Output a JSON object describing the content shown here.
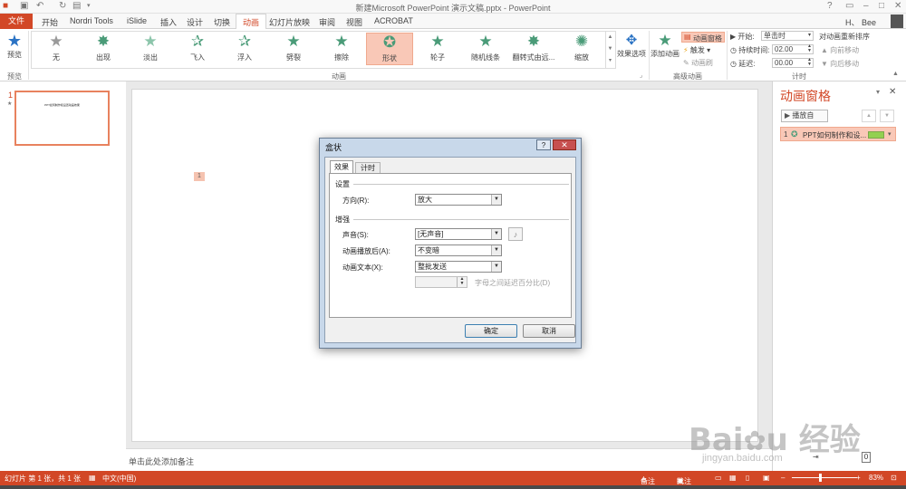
{
  "window": {
    "title": "新建Microsoft PowerPoint 演示文稿.pptx - PowerPoint",
    "help": "?",
    "user": "H、 Bee"
  },
  "tabs": [
    "文件",
    "开始",
    "Nordri Tools",
    "iSlide",
    "插入",
    "设计",
    "切换",
    "动画",
    "幻灯片放映",
    "审阅",
    "视图",
    "ACROBAT"
  ],
  "active_tab": "动画",
  "ribbon": {
    "preview_label": "预览",
    "preview_group": "预览",
    "animations": [
      "无",
      "出现",
      "淡出",
      "飞入",
      "浮入",
      "劈裂",
      "擦除",
      "形状",
      "轮子",
      "随机线条",
      "翻转式由远...",
      "缩放"
    ],
    "selected_animation": "形状",
    "effect_options": "效果选项",
    "animation_group": "动画",
    "add_animation": "添加动画",
    "animation_pane_btn": "动画窗格",
    "trigger": "触发",
    "animation_painter": "动画刷",
    "advanced_group": "高级动画",
    "start_label": "开始:",
    "start_value": "单击时",
    "duration_label": "持续时间:",
    "duration_value": "02.00",
    "delay_label": "延迟:",
    "delay_value": "00.00",
    "reorder_title": "对动画重新排序",
    "move_earlier": "向前移动",
    "move_later": "向后移动",
    "timing_group": "计时"
  },
  "thumb": {
    "number": "1",
    "star": "★",
    "text": "PPT如何制作和设置动画效果"
  },
  "slide": {
    "anim_marker": "1"
  },
  "notes_placeholder": "单击此处添加备注",
  "anim_pane": {
    "title": "动画窗格",
    "play_button": "播放自",
    "item_index": "1",
    "item_label": "PPT如何制作和设...",
    "item_color": "#92d050"
  },
  "dialog": {
    "title": "盒状",
    "tab_effect": "效果",
    "tab_timing": "计时",
    "section_settings": "设置",
    "direction_label": "方向(R):",
    "direction_value": "放大",
    "section_enhance": "增强",
    "sound_label": "声音(S):",
    "sound_value": "[无声音]",
    "after_label": "动画播放后(A):",
    "after_value": "不变暗",
    "text_label": "动画文本(X):",
    "text_value": "整批发送",
    "delay_between": "字母之间延迟百分比(D)",
    "ok": "确定",
    "cancel": "取消"
  },
  "status": {
    "slide_info": "幻灯片 第 1 张，共 1 张",
    "language": "中文(中国)",
    "notes": "备注",
    "comments": "批注",
    "zoom": "83%"
  },
  "watermark": {
    "site": "jingyan.baidu.com"
  },
  "colors": {
    "accent": "#d24726",
    "selected_gallery": "#f9c8b7",
    "dialog_frame": "#c8d8ea"
  }
}
